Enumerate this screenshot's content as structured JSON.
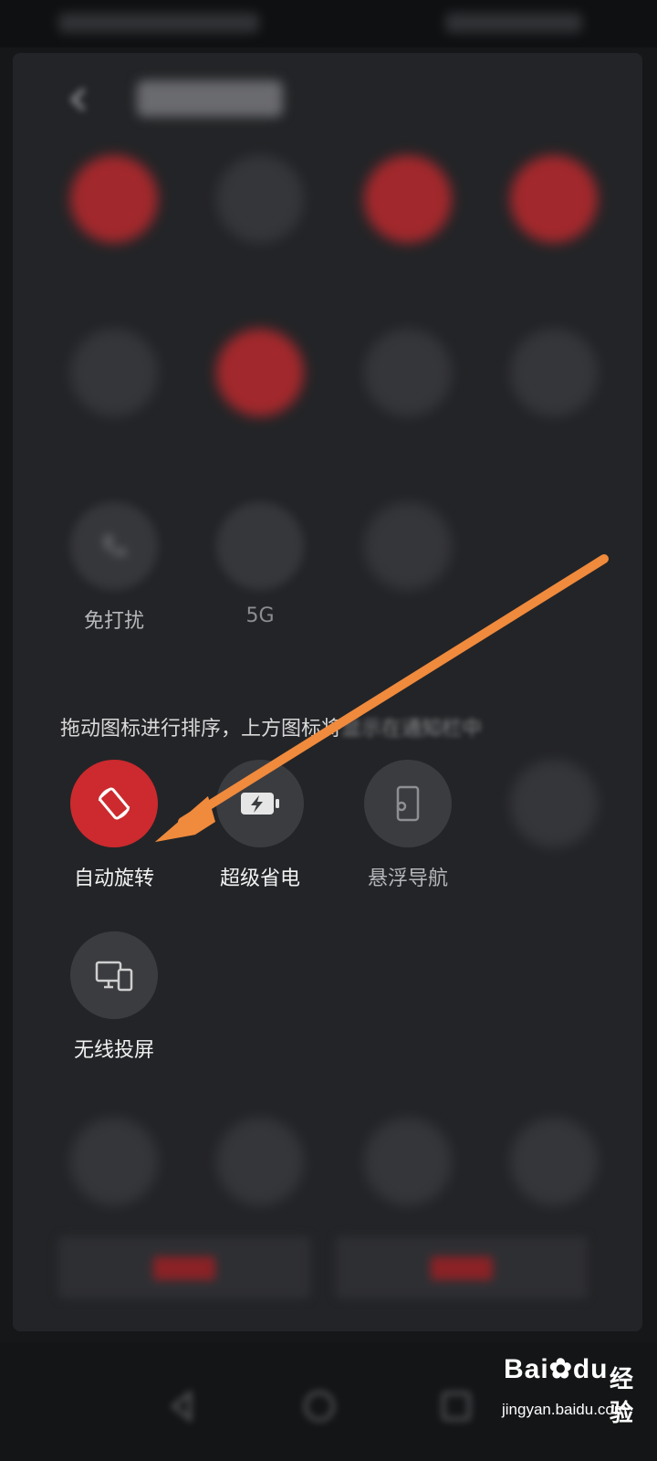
{
  "active_tiles": [
    {
      "label": "自动旋转",
      "icon": "rotate-icon",
      "on": true
    },
    {
      "label": "超级省电",
      "icon": "battery-charging-icon",
      "on": false
    },
    {
      "label": "悬浮导航",
      "icon": "floating-nav-icon",
      "on": false
    }
  ],
  "visible_tiles": [
    {
      "label": "免打扰",
      "icon": "phone-icon"
    },
    {
      "label": "5G",
      "icon": "signal-icon"
    }
  ],
  "wireless_tile": {
    "label": "无线投屏",
    "icon": "screen-cast-icon"
  },
  "hint": {
    "main": "拖动图标进行排序，上方图标将",
    "faded": "显示在通知栏中"
  },
  "watermark": {
    "logo_left": "Bai",
    "logo_right": "du",
    "text": "经验",
    "url": "jingyan.baidu.com"
  },
  "colors": {
    "accent": "#cc2a2e",
    "arrow": "#f08a3c",
    "tile_off": "#3b3c40"
  }
}
